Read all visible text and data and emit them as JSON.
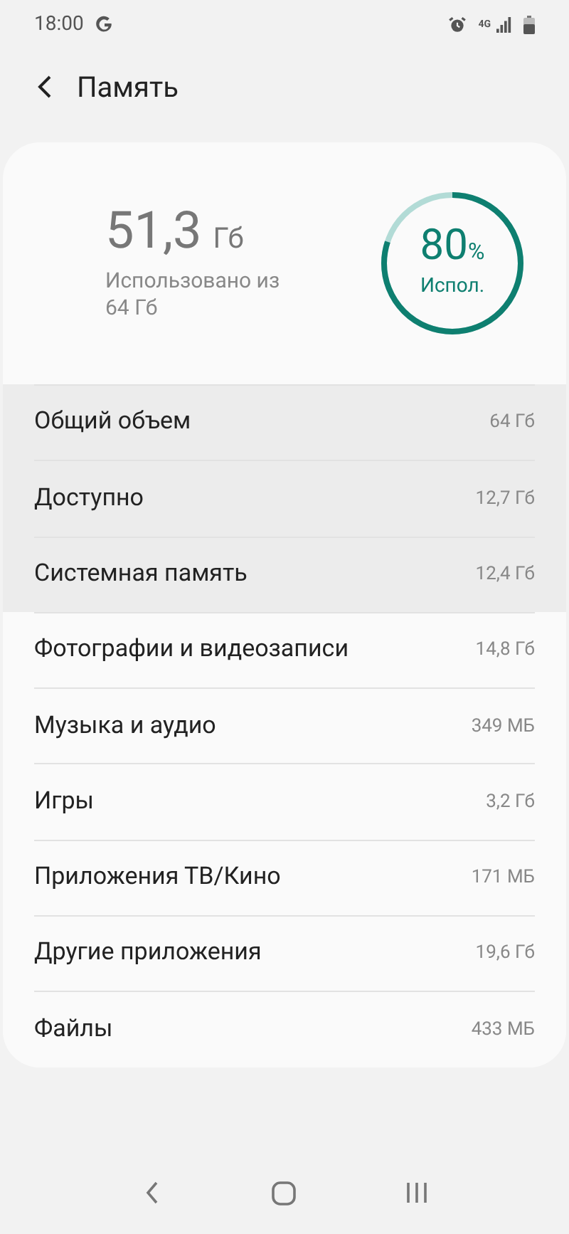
{
  "status_bar": {
    "time": "18:00",
    "network": "4G"
  },
  "header": {
    "title": "Память"
  },
  "summary": {
    "used": "51,3",
    "used_unit": "Гб",
    "caption": "Использовано из 64 Гб",
    "percent": "80",
    "percent_sign": "%",
    "percent_label": "Испол."
  },
  "rows": [
    {
      "label": "Общий объем",
      "value": "64 Гб",
      "highlighted": true
    },
    {
      "label": "Доступно",
      "value": "12,7 Гб",
      "highlighted": true
    },
    {
      "label": "Системная память",
      "value": "12,4 Гб",
      "highlighted": true
    },
    {
      "label": "Фотографии и видеозаписи",
      "value": "14,8 Гб",
      "highlighted": false
    },
    {
      "label": "Музыка и аудио",
      "value": "349 МБ",
      "highlighted": false
    },
    {
      "label": "Игры",
      "value": "3,2 Гб",
      "highlighted": false
    },
    {
      "label": "Приложения ТВ/Кино",
      "value": "171 МБ",
      "highlighted": false
    },
    {
      "label": "Другие приложения",
      "value": "19,6 Гб",
      "highlighted": false
    },
    {
      "label": "Файлы",
      "value": "433 МБ",
      "highlighted": false
    }
  ]
}
